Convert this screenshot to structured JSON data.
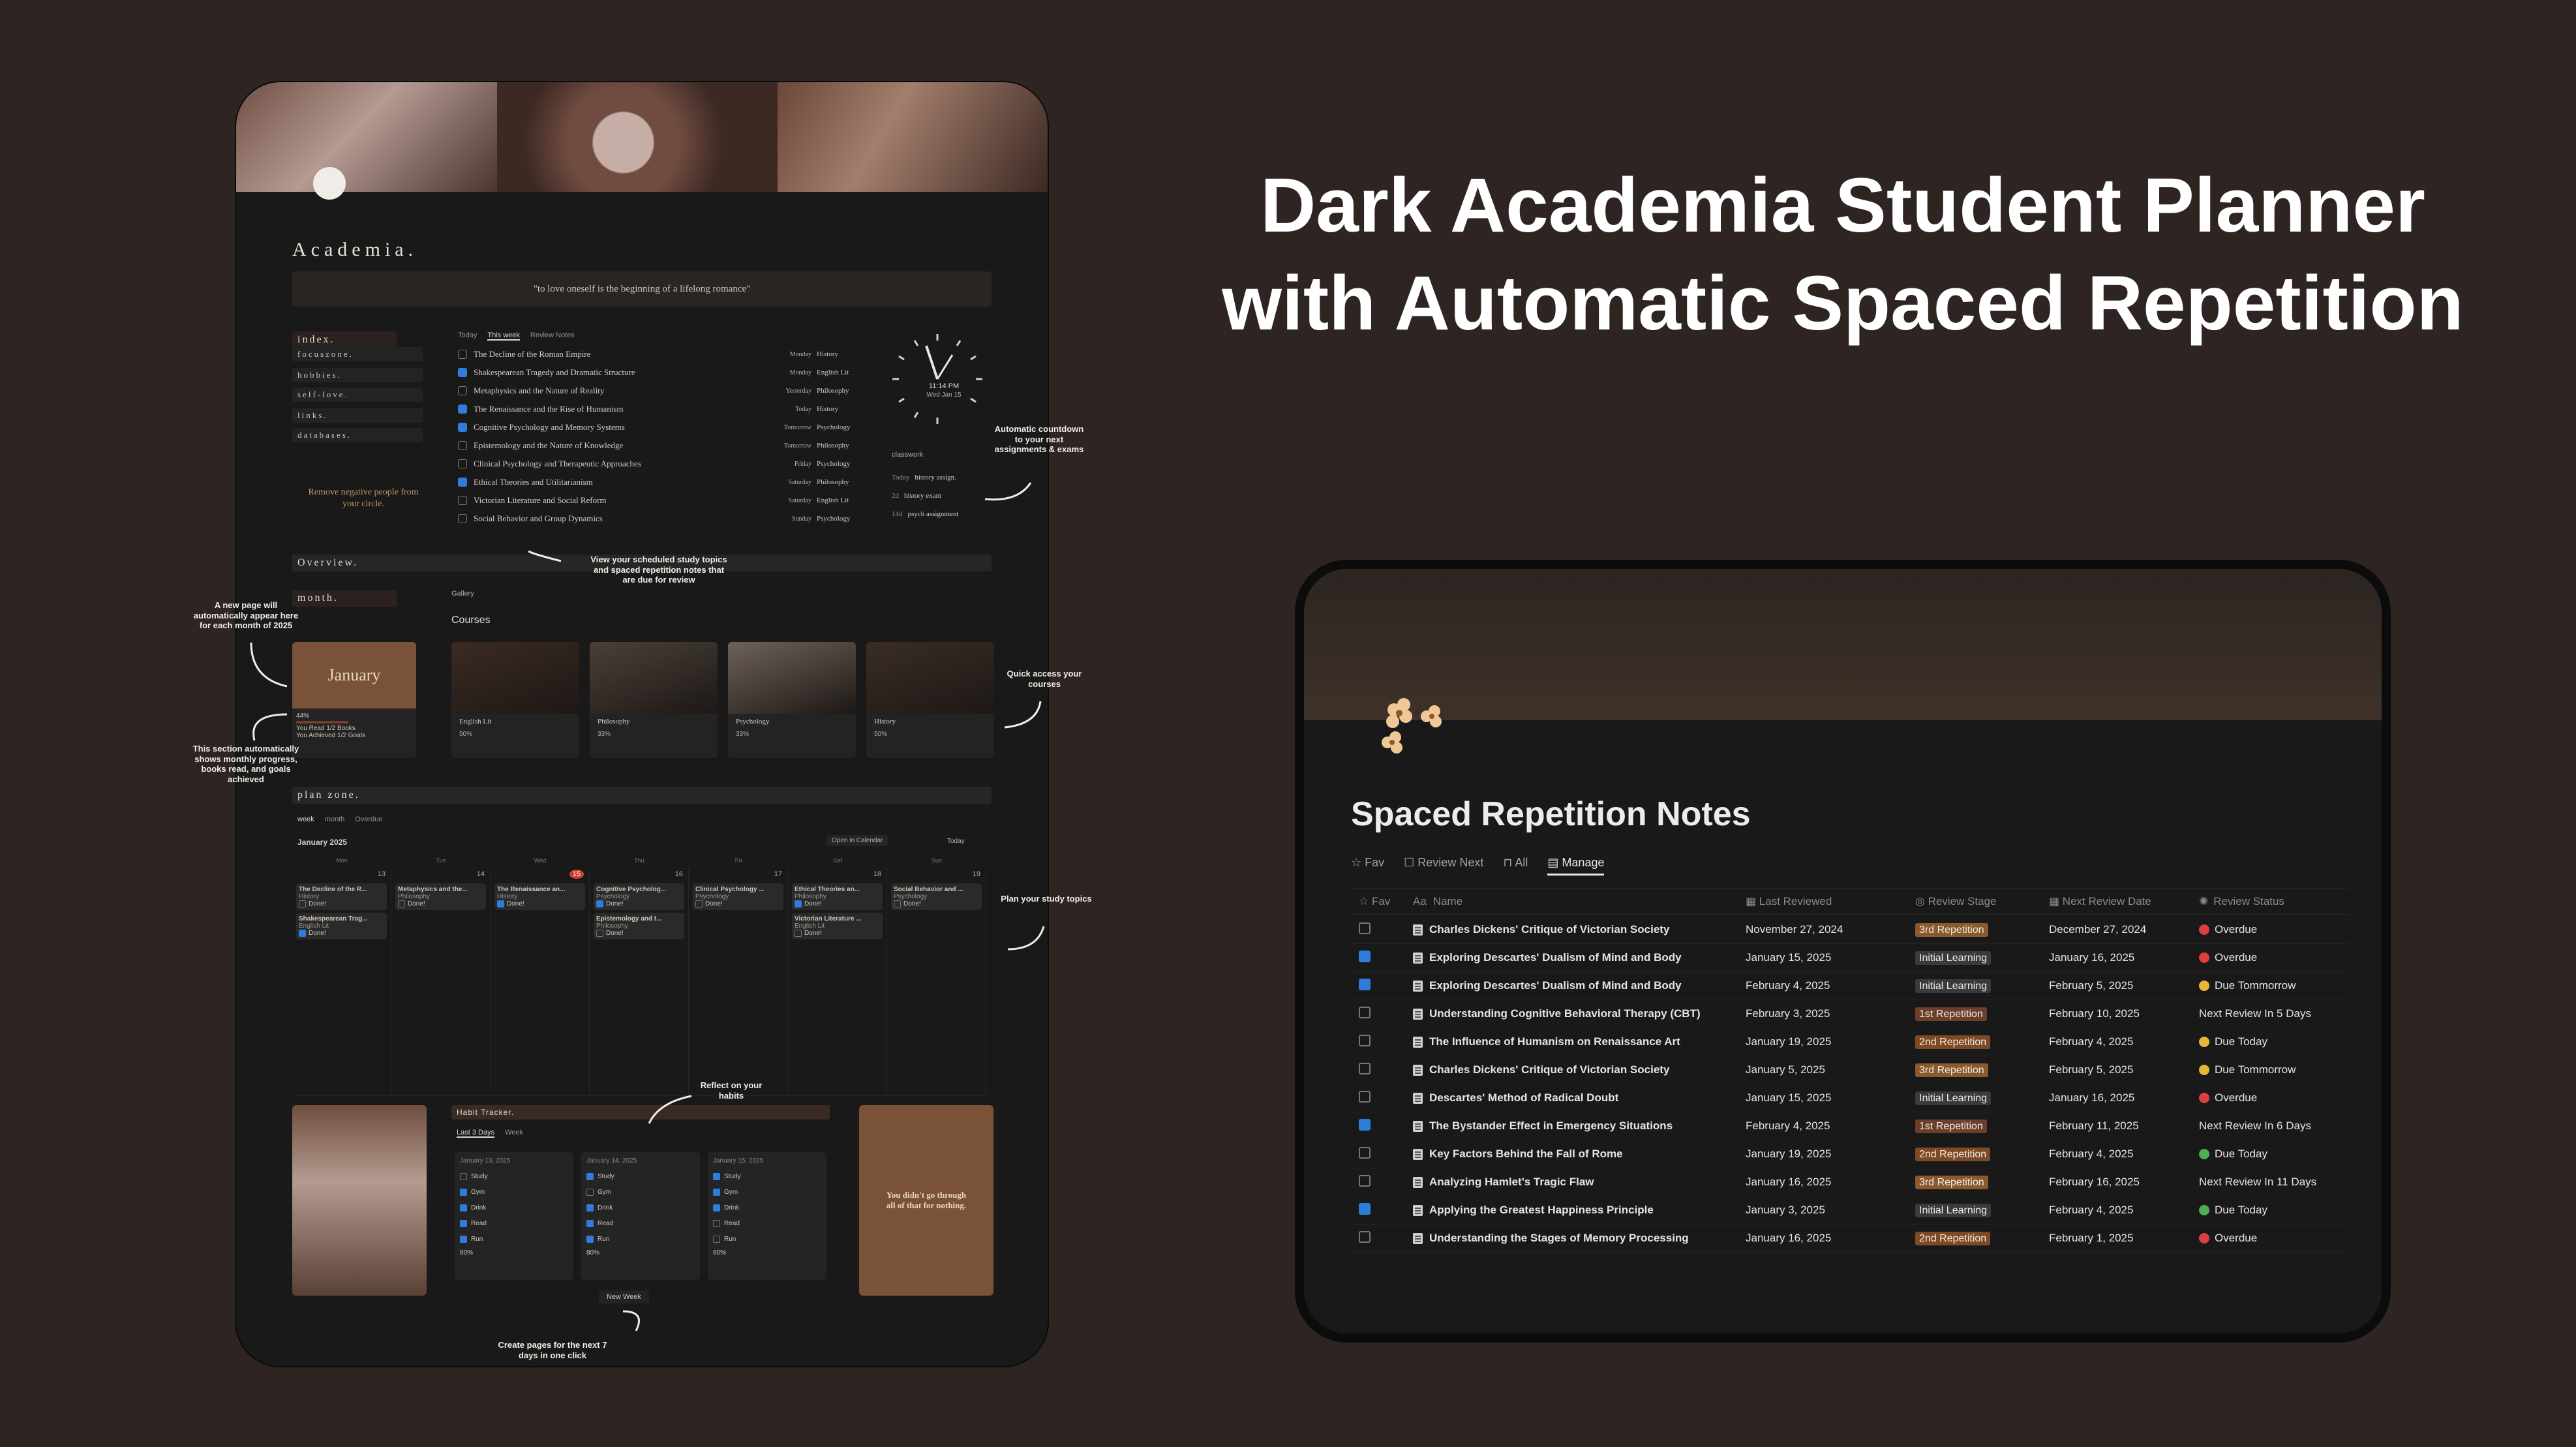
{
  "headline": "Dark Academia Student Planner with Automatic Spaced Repetition",
  "left": {
    "title": "Academia.",
    "quote": "\"to love oneself is the beginning of a lifelong romance\"",
    "index_label": "index.",
    "nav": [
      "focuszone.",
      "hobbies.",
      "self-love.",
      "links.",
      "databases."
    ],
    "reminder": "Remove negative people from your circle.",
    "tabs": [
      "Today",
      "This week",
      "Review Notes"
    ],
    "topics": [
      {
        "name": "The Decline of the Roman Empire",
        "day": "Monday",
        "subject": "History",
        "done": false
      },
      {
        "name": "Shakespearean Tragedy and Dramatic Structure",
        "day": "Monday",
        "subject": "English Lit",
        "done": true
      },
      {
        "name": "Metaphysics and the Nature of Reality",
        "day": "Yesterday",
        "subject": "Philosophy",
        "done": false
      },
      {
        "name": "The Renaissance and the Rise of Humanism",
        "day": "Today",
        "subject": "History",
        "done": true
      },
      {
        "name": "Cognitive Psychology and Memory Systems",
        "day": "Tomorrow",
        "subject": "Psychology",
        "done": true
      },
      {
        "name": "Epistemology and the Nature of Knowledge",
        "day": "Tomorrow",
        "subject": "Philosophy",
        "done": false
      },
      {
        "name": "Clinical Psychology and Therapeutic Approaches",
        "day": "Friday",
        "subject": "Psychology",
        "done": false
      },
      {
        "name": "Ethical Theories and Utilitarianism",
        "day": "Saturday",
        "subject": "Philosophy",
        "done": true
      },
      {
        "name": "Victorian Literature and Social Reform",
        "day": "Saturday",
        "subject": "English Lit",
        "done": false
      },
      {
        "name": "Social Behavior and Group Dynamics",
        "day": "Sunday",
        "subject": "Psychology",
        "done": false
      }
    ],
    "clock_time": "11:14 PM",
    "clock_date": "Wed Jan 15",
    "classwork_label": "classwork",
    "assignments": [
      {
        "when": "Today",
        "name": "history assign."
      },
      {
        "when": "2d",
        "name": "history exam"
      },
      {
        "when": "14d",
        "name": "psych assignment"
      }
    ],
    "overview_label": "Overview.",
    "month_label": "month.",
    "gallery_label": "Gallery",
    "courses_label": "Courses",
    "month_card": {
      "name": "January",
      "percent": "44%",
      "books": "You Read 1/2 Books",
      "goals": "You Achieved 1/2 Goals"
    },
    "courses": [
      {
        "name": "English Lit",
        "percent": "50%"
      },
      {
        "name": "Philosophy",
        "percent": "33%"
      },
      {
        "name": "Psychology",
        "percent": "33%"
      },
      {
        "name": "History",
        "percent": "50%"
      }
    ],
    "plan_label": "plan zone.",
    "plan_tabs": [
      "week",
      "month",
      "Overdue"
    ],
    "calendar_month": "January 2025",
    "open_calendar": "Open in Calendar",
    "today_btn": "Today",
    "weekdays": [
      "Mon",
      "Tue",
      "Wed",
      "Thu",
      "Fri",
      "Sat",
      "Sun"
    ],
    "dates": [
      "13",
      "14",
      "15",
      "16",
      "17",
      "18",
      "19"
    ],
    "done_label": "Done!",
    "cal_items": [
      [
        {
          "t": "The Decline of the R...",
          "s": "History",
          "d": false
        },
        {
          "t": "Shakespearean Trag...",
          "s": "English Lit",
          "d": true
        }
      ],
      [
        {
          "t": "Metaphysics and the...",
          "s": "Philosophy",
          "d": false
        }
      ],
      [
        {
          "t": "The Renaissance an...",
          "s": "History",
          "d": true
        }
      ],
      [
        {
          "t": "Cognitive Psycholog...",
          "s": "Psychology",
          "d": true
        },
        {
          "t": "Epistemology and t...",
          "s": "Philosophy",
          "d": false
        }
      ],
      [
        {
          "t": "Clinical Psychology ...",
          "s": "Psychology",
          "d": false
        }
      ],
      [
        {
          "t": "Ethical Theories an...",
          "s": "Philosophy",
          "d": true
        },
        {
          "t": "Victorian Literature ...",
          "s": "English Lit",
          "d": false
        }
      ],
      [
        {
          "t": "Social Behavior and ...",
          "s": "Psychology",
          "d": false
        }
      ]
    ],
    "habit_label": "Habit Tracker.",
    "habit_tabs": [
      "Last 3 Days",
      "Week"
    ],
    "habit_names": [
      "Study",
      "Gym",
      "Drink",
      "Read",
      "Run"
    ],
    "habits": [
      {
        "date": "January 13, 2025",
        "checks": [
          false,
          true,
          true,
          true,
          true
        ],
        "percent": "80%"
      },
      {
        "date": "January 14, 2025",
        "checks": [
          true,
          false,
          true,
          true,
          true
        ],
        "percent": "80%"
      },
      {
        "date": "January 15, 2025",
        "checks": [
          true,
          true,
          true,
          false,
          false
        ],
        "percent": "60%"
      }
    ],
    "new_week": "New Week",
    "motivation": "You didn't go through all of that for nothing.",
    "notes": {
      "n1": "A new page will automatically appear here for each month of 2025",
      "n2": "This section automatically shows monthly progress, books read, and goals achieved",
      "n3": "View your scheduled study topics and spaced repetition notes that are due for review",
      "n4": "Automatic countdown to your next assignments & exams",
      "n5": "Quick access your courses",
      "n6": "Plan your study topics",
      "n7": "Reflect on your habits",
      "n8": "Create pages for the next 7 days in one click"
    }
  },
  "right": {
    "title": "Spaced Repetition Notes",
    "tabs": [
      "Fav",
      "Review Next",
      "All",
      "Manage"
    ],
    "columns": [
      "Fav",
      "Name",
      "Last Reviewed",
      "Review Stage",
      "Next Review Date",
      "Review Status"
    ],
    "stage_colors": {
      "3rd Repetition": "#8a5a2e",
      "Initial Learning": "#3a3a3a",
      "1st Repetition": "#6b3f2a",
      "2nd Repetition": "#7d4a24"
    },
    "status_colors": {
      "red": "#e03e3e",
      "yellow": "#e8b43a",
      "green": "#4caf50"
    },
    "rows": [
      {
        "fav": false,
        "name": "Charles Dickens' Critique of Victorian Society",
        "last": "November 27, 2024",
        "stage": "3rd Repetition",
        "next": "December 27, 2024",
        "status": "Overdue",
        "dot": "red"
      },
      {
        "fav": true,
        "name": "Exploring Descartes' Dualism of Mind and Body",
        "last": "January 15, 2025",
        "stage": "Initial Learning",
        "next": "January 16, 2025",
        "status": "Overdue",
        "dot": "red"
      },
      {
        "fav": true,
        "name": "Exploring Descartes' Dualism of Mind and Body",
        "last": "February 4, 2025",
        "stage": "Initial Learning",
        "next": "February 5, 2025",
        "status": "Due Tommorrow",
        "dot": "yellow"
      },
      {
        "fav": false,
        "name": "Understanding Cognitive Behavioral Therapy (CBT)",
        "last": "February 3, 2025",
        "stage": "1st Repetition",
        "next": "February 10, 2025",
        "status": "Next Review In 5 Days",
        "dot": ""
      },
      {
        "fav": false,
        "name": "The Influence of Humanism on Renaissance Art",
        "last": "January 19, 2025",
        "stage": "2nd Repetition",
        "next": "February 4, 2025",
        "status": "Due Today",
        "dot": "yellow"
      },
      {
        "fav": false,
        "name": "Charles Dickens' Critique of Victorian Society",
        "last": "January 5, 2025",
        "stage": "3rd Repetition",
        "next": "February 5, 2025",
        "status": "Due Tommorrow",
        "dot": "yellow"
      },
      {
        "fav": false,
        "name": "Descartes' Method of Radical Doubt",
        "last": "January 15, 2025",
        "stage": "Initial Learning",
        "next": "January 16, 2025",
        "status": "Overdue",
        "dot": "red"
      },
      {
        "fav": true,
        "name": "The Bystander Effect in Emergency Situations",
        "last": "February 4, 2025",
        "stage": "1st Repetition",
        "next": "February 11, 2025",
        "status": "Next Review In 6 Days",
        "dot": ""
      },
      {
        "fav": false,
        "name": "Key Factors Behind the Fall of Rome",
        "last": "January 19, 2025",
        "stage": "2nd Repetition",
        "next": "February 4, 2025",
        "status": "Due Today",
        "dot": "green"
      },
      {
        "fav": false,
        "name": "Analyzing Hamlet's Tragic Flaw",
        "last": "January 16, 2025",
        "stage": "3rd Repetition",
        "next": "February 16, 2025",
        "status": "Next Review In 11 Days",
        "dot": ""
      },
      {
        "fav": true,
        "name": "Applying the Greatest Happiness Principle",
        "last": "January 3, 2025",
        "stage": "Initial Learning",
        "next": "February 4, 2025",
        "status": "Due Today",
        "dot": "green"
      },
      {
        "fav": false,
        "name": "Understanding the Stages of Memory Processing",
        "last": "January 16, 2025",
        "stage": "2nd Repetition",
        "next": "February 1, 2025",
        "status": "Overdue",
        "dot": "red"
      }
    ]
  }
}
